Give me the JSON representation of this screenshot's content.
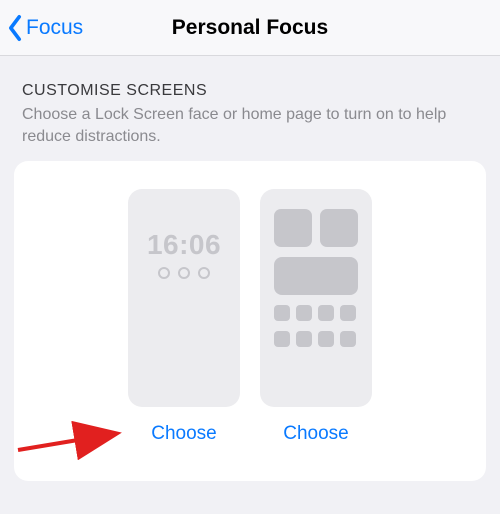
{
  "nav": {
    "back_label": "Focus",
    "title": "Personal Focus"
  },
  "section": {
    "header": "CUSTOMISE SCREENS",
    "description": "Choose a Lock Screen face or home page to turn on to help reduce distractions."
  },
  "lock_preview": {
    "time": "16:06",
    "choose_label": "Choose"
  },
  "home_preview": {
    "choose_label": "Choose"
  },
  "colors": {
    "accent": "#0a7aff",
    "placeholder": "#c6c6cb",
    "card_bg": "#ffffff",
    "page_bg": "#f1f1f5"
  },
  "annotation": {
    "arrow_points_to": "lock-screen-choose-button",
    "arrow_color": "#e1201f"
  }
}
